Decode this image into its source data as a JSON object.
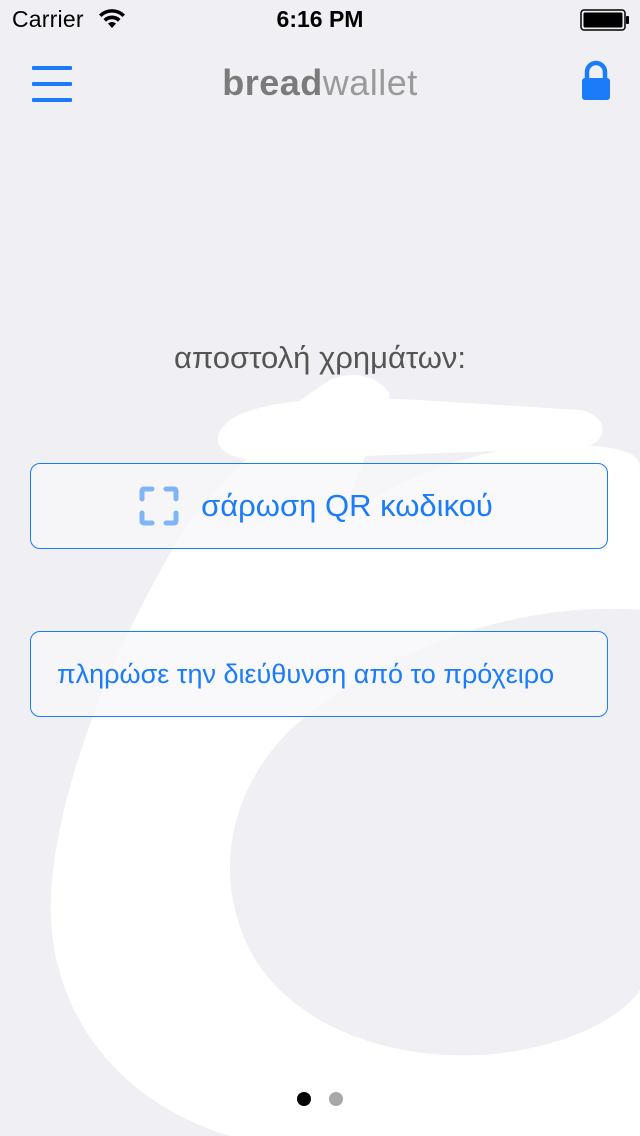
{
  "status_bar": {
    "carrier": "Carrier",
    "time": "6:16 PM",
    "wifi_icon": "wifi-icon",
    "battery_icon": "battery-icon"
  },
  "nav": {
    "menu_icon": "hamburger-menu-icon",
    "logo_bread": "bread",
    "logo_wallet": "wallet",
    "lock_icon": "lock-icon",
    "accent_color": "#1a7cf8"
  },
  "main": {
    "heading": "αποστολή χρημάτων:",
    "scan_button": {
      "icon": "qr-scan-icon",
      "label": "σάρωση QR κωδικού"
    },
    "paste_button": {
      "label": "πληρώσε την διεύθυνση από το πρόχειρο"
    }
  },
  "page_indicator": {
    "page_count": 2,
    "current_page": 1
  },
  "colors": {
    "background": "#efeff4",
    "accent": "#1a7cf8",
    "heading_text": "#555555"
  }
}
